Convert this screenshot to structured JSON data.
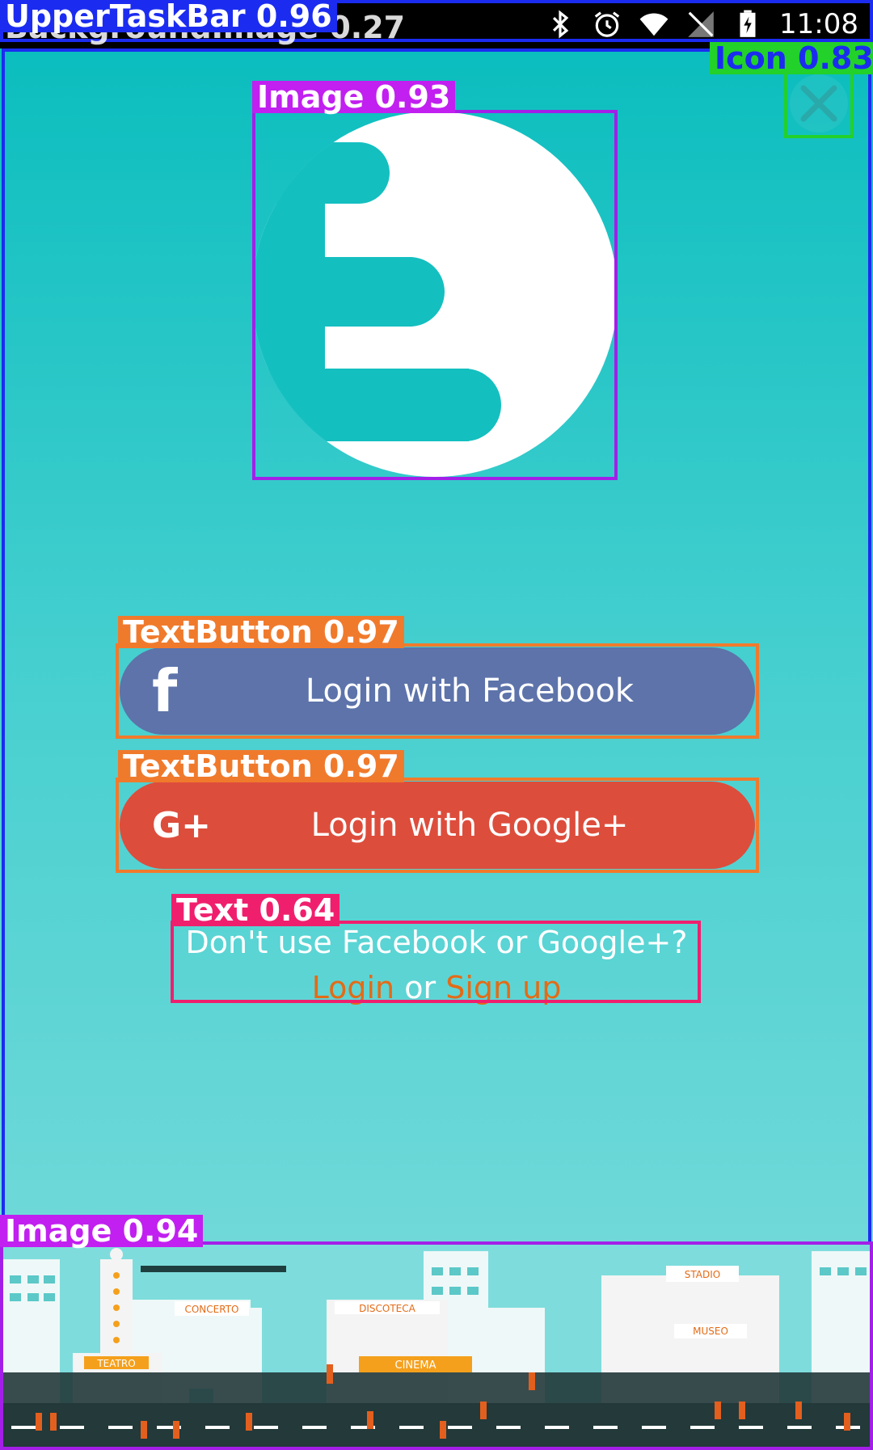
{
  "status_bar": {
    "time": "11:08"
  },
  "facebook_button": {
    "label": "Login with Facebook",
    "icon": "f"
  },
  "google_button": {
    "label": "Login with Google+",
    "icon": "G+"
  },
  "alternative": {
    "question": "Don't use Facebook or Google+?",
    "login": "Login",
    "or": "or",
    "signup": "Sign up"
  },
  "city_signs": {
    "teatro": "TEATRO",
    "concerto": "CONCERTO",
    "discoteca": "DISCOTECA",
    "cinema": "CINEMA",
    "stadio": "STADIO",
    "museo": "MUSEO"
  },
  "annotations": {
    "upper_taskbar": "UpperTaskBar 0.96",
    "background_image": "BackgroundImage 0.27",
    "icon": "Icon 0.83",
    "logo_image": "Image 0.93",
    "textbutton_facebook": "TextButton 0.97",
    "textbutton_google": "TextButton 0.97",
    "text": "Text 0.64",
    "city_image": "Image 0.94"
  },
  "colors": {
    "teal": "#06bfc0",
    "facebook": "#5d73aa",
    "google": "#dd4d3c",
    "link": "#e36b16"
  }
}
